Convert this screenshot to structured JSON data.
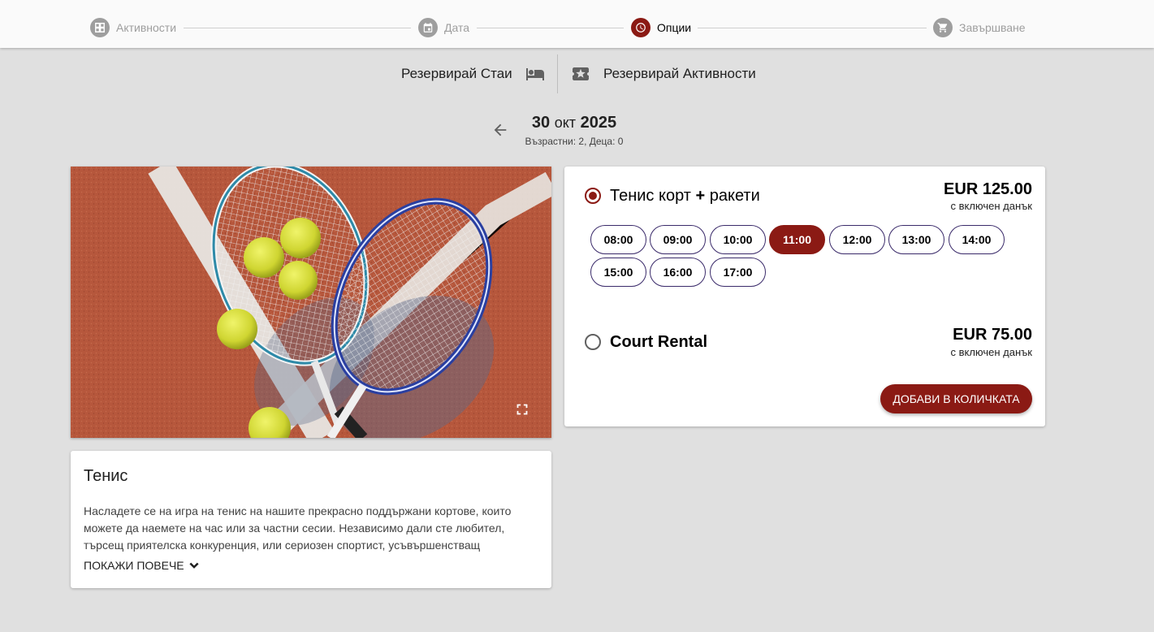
{
  "stepper": {
    "steps": [
      {
        "label": "Активности",
        "icon": "grid-icon",
        "state": "done"
      },
      {
        "label": "Дата",
        "icon": "calendar-icon",
        "state": "done"
      },
      {
        "label": "Опции",
        "icon": "clock-icon",
        "state": "active"
      },
      {
        "label": "Завършване",
        "icon": "cart-icon",
        "state": "pending"
      }
    ]
  },
  "booking_type": {
    "rooms_label": "Резервирай Стаи",
    "rooms_icon": "bed-icon",
    "activities_label": "Резервирай Активности",
    "activities_icon": "ticket-star-icon"
  },
  "date_header": {
    "day": "30",
    "month": "окт",
    "year": "2025",
    "guests": "Възрастни: 2, Деца: 0",
    "back_icon": "arrow-left-icon"
  },
  "activity": {
    "image_icon": "fullscreen-icon",
    "title": "Тенис",
    "description": "Насладете се на игра на тенис на нашите прекрасно поддържани кортове, които можете да наемете на час или за частни сесии. Независимо дали сте любител, търсещ приятелска конкуренция, или сериозен спортист, усъвършенстващ уменията...",
    "show_more": "Покажи повече",
    "show_more_icon": "chevron-down-icon"
  },
  "options": [
    {
      "name_part1": "Тенис корт",
      "name_plus": "+",
      "name_part2": "ракети",
      "price": "EUR 125.00",
      "tax_note": "с включен данък",
      "selected": true,
      "slots": [
        "08:00",
        "09:00",
        "10:00",
        "11:00",
        "12:00",
        "13:00",
        "14:00",
        "15:00",
        "16:00",
        "17:00"
      ],
      "selected_slot": "11:00"
    },
    {
      "name": "Court Rental",
      "price": "EUR 75.00",
      "tax_note": "с включен данък",
      "selected": false
    }
  ],
  "cart": {
    "add_label": "Добави в количката"
  },
  "colors": {
    "accent": "#8b1a14",
    "slot_border": "#3a2a6a",
    "background": "#e0e0e0"
  }
}
